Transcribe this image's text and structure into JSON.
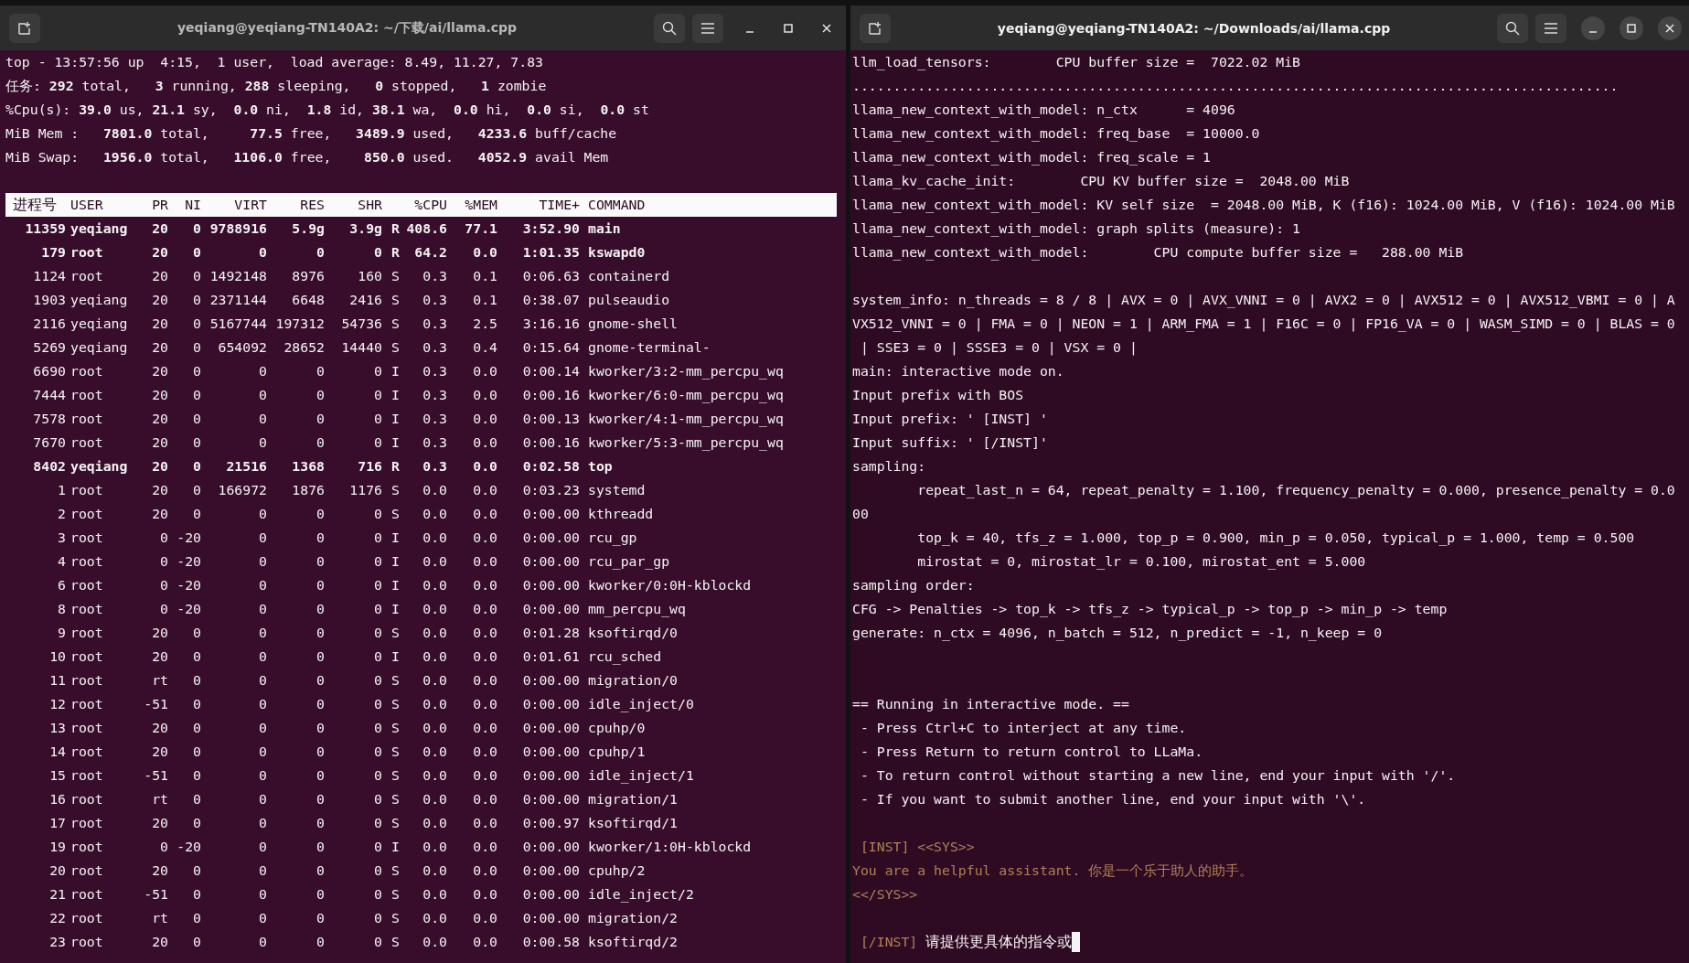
{
  "windows": [
    {
      "title": "yeqiang@yeqiang-TN140A2: ~/下载/ai/llama.cpp",
      "focused": false,
      "kind": "top",
      "summary": [
        "top - 13:57:56 up  4:15,  1 user,  load average: 8.49, 11.27, 7.83",
        "任务: **292** total,   **3** running, **288** sleeping,   **0** stopped,   **1** zombie",
        "%Cpu(s): **39.0** us, **21.1** sy,  **0.0** ni,  **1.8** id, **38.1** wa,  **0.0** hi,  **0.0** si,  **0.0** st",
        "MiB Mem :   **7801.0** total,     **77.5** free,   **3489.9** used,   **4233.6** buff/cache",
        "MiB Swap:   **1956.0** total,   **1106.0** free,    **850.0** used.   **4052.9** avail Mem"
      ],
      "table": {
        "columns": [
          "进程号",
          "USER",
          "PR",
          "NI",
          "VIRT",
          "RES",
          "SHR",
          "",
          "%CPU",
          "%MEM",
          "TIME+",
          "COMMAND"
        ],
        "rows": [
          {
            "bold": true,
            "cells": [
              "11359",
              "yeqiang",
              "20",
              "0",
              "9788916",
              "5.9g",
              "3.9g",
              "R",
              "408.6",
              "77.1",
              "3:52.90",
              "main"
            ]
          },
          {
            "bold": true,
            "cells": [
              "179",
              "root",
              "20",
              "0",
              "0",
              "0",
              "0",
              "R",
              "64.2",
              "0.0",
              "1:01.35",
              "kswapd0"
            ]
          },
          {
            "bold": false,
            "cells": [
              "1124",
              "root",
              "20",
              "0",
              "1492148",
              "8976",
              "160",
              "S",
              "0.3",
              "0.1",
              "0:06.63",
              "containerd"
            ]
          },
          {
            "bold": false,
            "cells": [
              "1903",
              "yeqiang",
              "20",
              "0",
              "2371144",
              "6648",
              "2416",
              "S",
              "0.3",
              "0.1",
              "0:38.07",
              "pulseaudio"
            ]
          },
          {
            "bold": false,
            "cells": [
              "2116",
              "yeqiang",
              "20",
              "0",
              "5167744",
              "197312",
              "54736",
              "S",
              "0.3",
              "2.5",
              "3:16.16",
              "gnome-shell"
            ]
          },
          {
            "bold": false,
            "cells": [
              "5269",
              "yeqiang",
              "20",
              "0",
              "654092",
              "28652",
              "14440",
              "S",
              "0.3",
              "0.4",
              "0:15.64",
              "gnome-terminal-"
            ]
          },
          {
            "bold": false,
            "cells": [
              "6690",
              "root",
              "20",
              "0",
              "0",
              "0",
              "0",
              "I",
              "0.3",
              "0.0",
              "0:00.14",
              "kworker/3:2-mm_percpu_wq"
            ]
          },
          {
            "bold": false,
            "cells": [
              "7444",
              "root",
              "20",
              "0",
              "0",
              "0",
              "0",
              "I",
              "0.3",
              "0.0",
              "0:00.16",
              "kworker/6:0-mm_percpu_wq"
            ]
          },
          {
            "bold": false,
            "cells": [
              "7578",
              "root",
              "20",
              "0",
              "0",
              "0",
              "0",
              "I",
              "0.3",
              "0.0",
              "0:00.13",
              "kworker/4:1-mm_percpu_wq"
            ]
          },
          {
            "bold": false,
            "cells": [
              "7670",
              "root",
              "20",
              "0",
              "0",
              "0",
              "0",
              "I",
              "0.3",
              "0.0",
              "0:00.16",
              "kworker/5:3-mm_percpu_wq"
            ]
          },
          {
            "bold": true,
            "cells": [
              "8402",
              "yeqiang",
              "20",
              "0",
              "21516",
              "1368",
              "716",
              "R",
              "0.3",
              "0.0",
              "0:02.58",
              "top"
            ]
          },
          {
            "bold": false,
            "cells": [
              "1",
              "root",
              "20",
              "0",
              "166972",
              "1876",
              "1176",
              "S",
              "0.0",
              "0.0",
              "0:03.23",
              "systemd"
            ]
          },
          {
            "bold": false,
            "cells": [
              "2",
              "root",
              "20",
              "0",
              "0",
              "0",
              "0",
              "S",
              "0.0",
              "0.0",
              "0:00.00",
              "kthreadd"
            ]
          },
          {
            "bold": false,
            "cells": [
              "3",
              "root",
              "0",
              "-20",
              "0",
              "0",
              "0",
              "I",
              "0.0",
              "0.0",
              "0:00.00",
              "rcu_gp"
            ]
          },
          {
            "bold": false,
            "cells": [
              "4",
              "root",
              "0",
              "-20",
              "0",
              "0",
              "0",
              "I",
              "0.0",
              "0.0",
              "0:00.00",
              "rcu_par_gp"
            ]
          },
          {
            "bold": false,
            "cells": [
              "6",
              "root",
              "0",
              "-20",
              "0",
              "0",
              "0",
              "I",
              "0.0",
              "0.0",
              "0:00.00",
              "kworker/0:0H-kblockd"
            ]
          },
          {
            "bold": false,
            "cells": [
              "8",
              "root",
              "0",
              "-20",
              "0",
              "0",
              "0",
              "I",
              "0.0",
              "0.0",
              "0:00.00",
              "mm_percpu_wq"
            ]
          },
          {
            "bold": false,
            "cells": [
              "9",
              "root",
              "20",
              "0",
              "0",
              "0",
              "0",
              "S",
              "0.0",
              "0.0",
              "0:01.28",
              "ksoftirqd/0"
            ]
          },
          {
            "bold": false,
            "cells": [
              "10",
              "root",
              "20",
              "0",
              "0",
              "0",
              "0",
              "I",
              "0.0",
              "0.0",
              "0:01.61",
              "rcu_sched"
            ]
          },
          {
            "bold": false,
            "cells": [
              "11",
              "root",
              "rt",
              "0",
              "0",
              "0",
              "0",
              "S",
              "0.0",
              "0.0",
              "0:00.00",
              "migration/0"
            ]
          },
          {
            "bold": false,
            "cells": [
              "12",
              "root",
              "-51",
              "0",
              "0",
              "0",
              "0",
              "S",
              "0.0",
              "0.0",
              "0:00.00",
              "idle_inject/0"
            ]
          },
          {
            "bold": false,
            "cells": [
              "13",
              "root",
              "20",
              "0",
              "0",
              "0",
              "0",
              "S",
              "0.0",
              "0.0",
              "0:00.00",
              "cpuhp/0"
            ]
          },
          {
            "bold": false,
            "cells": [
              "14",
              "root",
              "20",
              "0",
              "0",
              "0",
              "0",
              "S",
              "0.0",
              "0.0",
              "0:00.00",
              "cpuhp/1"
            ]
          },
          {
            "bold": false,
            "cells": [
              "15",
              "root",
              "-51",
              "0",
              "0",
              "0",
              "0",
              "S",
              "0.0",
              "0.0",
              "0:00.00",
              "idle_inject/1"
            ]
          },
          {
            "bold": false,
            "cells": [
              "16",
              "root",
              "rt",
              "0",
              "0",
              "0",
              "0",
              "S",
              "0.0",
              "0.0",
              "0:00.00",
              "migration/1"
            ]
          },
          {
            "bold": false,
            "cells": [
              "17",
              "root",
              "20",
              "0",
              "0",
              "0",
              "0",
              "S",
              "0.0",
              "0.0",
              "0:00.97",
              "ksoftirqd/1"
            ]
          },
          {
            "bold": false,
            "cells": [
              "19",
              "root",
              "0",
              "-20",
              "0",
              "0",
              "0",
              "I",
              "0.0",
              "0.0",
              "0:00.00",
              "kworker/1:0H-kblockd"
            ]
          },
          {
            "bold": false,
            "cells": [
              "20",
              "root",
              "20",
              "0",
              "0",
              "0",
              "0",
              "S",
              "0.0",
              "0.0",
              "0:00.00",
              "cpuhp/2"
            ]
          },
          {
            "bold": false,
            "cells": [
              "21",
              "root",
              "-51",
              "0",
              "0",
              "0",
              "0",
              "S",
              "0.0",
              "0.0",
              "0:00.00",
              "idle_inject/2"
            ]
          },
          {
            "bold": false,
            "cells": [
              "22",
              "root",
              "rt",
              "0",
              "0",
              "0",
              "0",
              "S",
              "0.0",
              "0.0",
              "0:00.00",
              "migration/2"
            ]
          },
          {
            "bold": false,
            "cells": [
              "23",
              "root",
              "20",
              "0",
              "0",
              "0",
              "0",
              "S",
              "0.0",
              "0.0",
              "0:00.58",
              "ksoftirqd/2"
            ]
          }
        ]
      }
    },
    {
      "title": "yeqiang@yeqiang-TN140A2: ~/Downloads/ai/llama.cpp",
      "focused": true,
      "kind": "log",
      "lines": [
        {
          "kind": "out",
          "text": "llm_load_tensors:        CPU buffer size =  7022.02 MiB"
        },
        {
          "kind": "out",
          "text": ".............................................................................................."
        },
        {
          "kind": "out",
          "text": "llama_new_context_with_model: n_ctx      = 4096"
        },
        {
          "kind": "out",
          "text": "llama_new_context_with_model: freq_base  = 10000.0"
        },
        {
          "kind": "out",
          "text": "llama_new_context_with_model: freq_scale = 1"
        },
        {
          "kind": "out",
          "text": "llama_kv_cache_init:        CPU KV buffer size =  2048.00 MiB"
        },
        {
          "kind": "out",
          "text": "llama_new_context_with_model: KV self size  = 2048.00 MiB, K (f16): 1024.00 MiB, V (f16): 1024.00 MiB"
        },
        {
          "kind": "out",
          "text": "llama_new_context_with_model: graph splits (measure): 1"
        },
        {
          "kind": "out",
          "text": "llama_new_context_with_model:        CPU compute buffer size =   288.00 MiB"
        },
        {
          "kind": "blank"
        },
        {
          "kind": "out",
          "text": "system_info: n_threads = 8 / 8 | AVX = 0 | AVX_VNNI = 0 | AVX2 = 0 | AVX512 = 0 | AVX512_VBMI = 0 | A"
        },
        {
          "kind": "out",
          "text": "VX512_VNNI = 0 | FMA = 0 | NEON = 1 | ARM_FMA = 1 | F16C = 0 | FP16_VA = 0 | WASM_SIMD = 0 | BLAS = 0"
        },
        {
          "kind": "out",
          "text": " | SSE3 = 0 | SSSE3 = 0 | VSX = 0 |"
        },
        {
          "kind": "out",
          "text": "main: interactive mode on."
        },
        {
          "kind": "out",
          "text": "Input prefix with BOS"
        },
        {
          "kind": "out",
          "text": "Input prefix: ' [INST] '"
        },
        {
          "kind": "out",
          "text": "Input suffix: ' [/INST]'"
        },
        {
          "kind": "out",
          "text": "sampling:"
        },
        {
          "kind": "out",
          "text": "        repeat_last_n = 64, repeat_penalty = 1.100, frequency_penalty = 0.000, presence_penalty = 0.0"
        },
        {
          "kind": "out",
          "text": "00"
        },
        {
          "kind": "out",
          "text": "        top_k = 40, tfs_z = 1.000, top_p = 0.900, min_p = 0.050, typical_p = 1.000, temp = 0.500"
        },
        {
          "kind": "out",
          "text": "        mirostat = 0, mirostat_lr = 0.100, mirostat_ent = 5.000"
        },
        {
          "kind": "out",
          "text": "sampling order:"
        },
        {
          "kind": "out",
          "text": "CFG -> Penalties -> top_k -> tfs_z -> typical_p -> top_p -> min_p -> temp"
        },
        {
          "kind": "out",
          "text": "generate: n_ctx = 4096, n_batch = 512, n_predict = -1, n_keep = 0"
        },
        {
          "kind": "blank"
        },
        {
          "kind": "blank"
        },
        {
          "kind": "out",
          "text": "== Running in interactive mode. =="
        },
        {
          "kind": "out",
          "text": " - Press Ctrl+C to interject at any time."
        },
        {
          "kind": "out",
          "text": " - Press Return to return control to LLaMa."
        },
        {
          "kind": "out",
          "text": " - To return control without starting a new line, end your input with '/'."
        },
        {
          "kind": "out",
          "text": " - If you want to submit another line, end your input with '\\'."
        },
        {
          "kind": "blank"
        },
        {
          "kind": "prompt",
          "text": " [INST] <<SYS>>"
        },
        {
          "kind": "prompt",
          "text": "You are a helpful assistant. 你是一个乐于助人的助手。"
        },
        {
          "kind": "prompt",
          "text": "<</SYS>>"
        },
        {
          "kind": "blank"
        },
        {
          "kind": "input",
          "prefix": " [/INST] ",
          "text": "请提供更具体的指令或"
        }
      ]
    }
  ]
}
